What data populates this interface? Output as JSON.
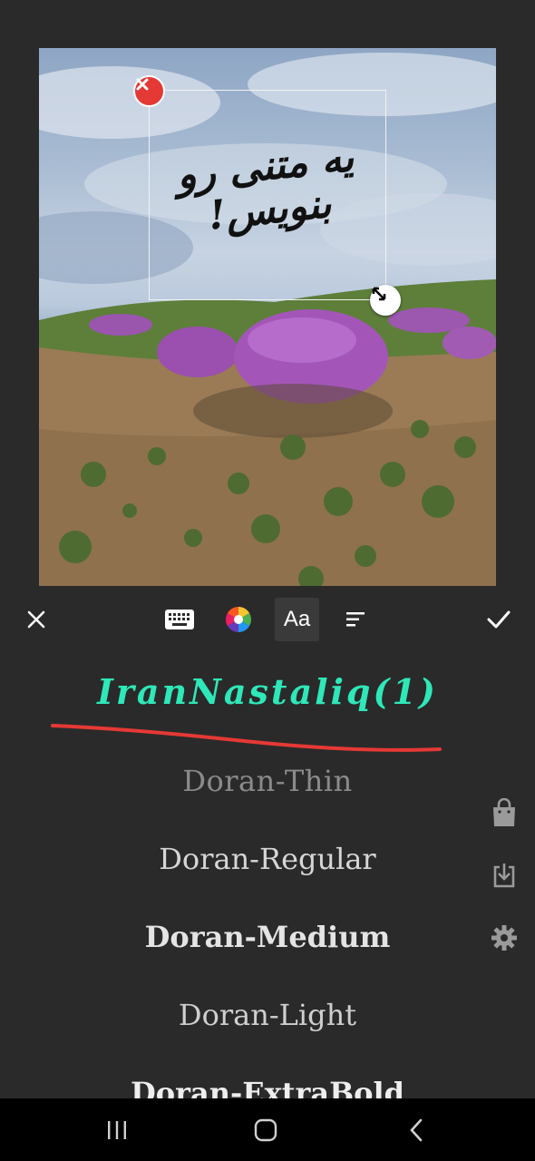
{
  "canvas": {
    "overlay_text": "یه متنی رو بنویس!"
  },
  "toolbar": {
    "close_icon": "close-icon",
    "keyboard_icon": "keyboard-icon",
    "color_icon": "color-wheel-icon",
    "font_label": "Aa",
    "align_icon": "align-left-icon",
    "confirm_icon": "check-icon"
  },
  "fonts": {
    "selected": "IranNastaliq(1)",
    "items": [
      "Doran-Thin",
      "Doran-Regular",
      "Doran-Medium",
      "Doran-Light",
      "Doran-ExtraBold"
    ]
  },
  "side_actions": [
    "shopping-bag-icon",
    "download-icon",
    "settings-icon"
  ],
  "colors": {
    "accent": "#2ee8b8",
    "delete": "#e53935",
    "annotation": "#e53935",
    "background": "#2a2a2a"
  }
}
